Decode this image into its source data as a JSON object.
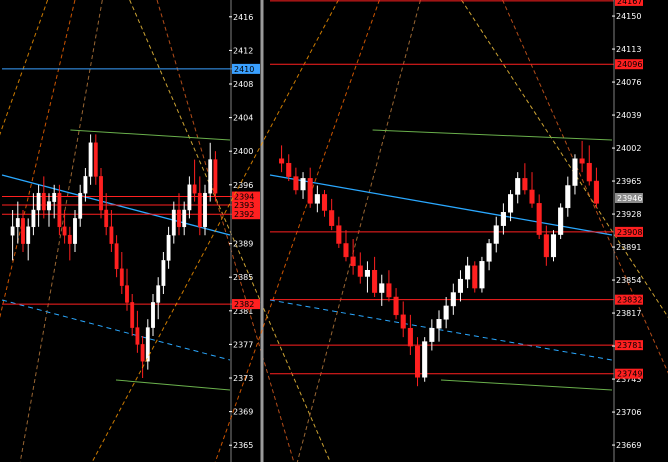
{
  "chart_data": [
    {
      "type": "candlestick",
      "y_ticks": [
        2416,
        2412,
        2408,
        2404,
        2400,
        2396,
        2389,
        2385,
        2381,
        2377,
        2373,
        2369,
        2365
      ],
      "ylim": [
        2363,
        2418
      ],
      "badges": [
        {
          "label": "2410",
          "price": 2409.8,
          "bg": "#3aa0ff",
          "fg": "#000000"
        },
        {
          "label": "2394",
          "price": 2394.6,
          "bg": "#ff2020",
          "fg": "#000000"
        },
        {
          "label": "2393",
          "price": 2393.6,
          "bg": "#ff2020",
          "fg": "#000000"
        },
        {
          "label": "2392",
          "price": 2392.5,
          "bg": "#ff2020",
          "fg": "#000000"
        },
        {
          "label": "2382",
          "price": 2381.8,
          "bg": "#ff2020",
          "fg": "#000000"
        }
      ],
      "candles": [
        [
          2390,
          2393,
          2387,
          2391
        ],
        [
          2391,
          2394,
          2389,
          2392
        ],
        [
          2392,
          2393,
          2388,
          2389
        ],
        [
          2389,
          2392,
          2387,
          2391
        ],
        [
          2391,
          2395,
          2390,
          2393
        ],
        [
          2393,
          2396,
          2391,
          2395
        ],
        [
          2395,
          2397,
          2392,
          2393
        ],
        [
          2393,
          2395,
          2391,
          2394
        ],
        [
          2394,
          2396,
          2392,
          2395
        ],
        [
          2395,
          2396,
          2390,
          2391
        ],
        [
          2391,
          2393,
          2389,
          2390
        ],
        [
          2390,
          2391,
          2387,
          2389
        ],
        [
          2389,
          2393,
          2388,
          2392
        ],
        [
          2392,
          2396,
          2391,
          2395
        ],
        [
          2395,
          2398,
          2394,
          2397
        ],
        [
          2397,
          2402,
          2396,
          2401
        ],
        [
          2401,
          2402,
          2396,
          2397
        ],
        [
          2397,
          2398,
          2392,
          2393
        ],
        [
          2393,
          2395,
          2390,
          2391
        ],
        [
          2391,
          2393,
          2388,
          2389
        ],
        [
          2389,
          2390,
          2385,
          2386
        ],
        [
          2386,
          2388,
          2383,
          2384
        ],
        [
          2384,
          2386,
          2381,
          2382
        ],
        [
          2382,
          2383,
          2378,
          2379
        ],
        [
          2379,
          2381,
          2376,
          2377
        ],
        [
          2377,
          2378,
          2373,
          2375
        ],
        [
          2375,
          2380,
          2374,
          2379
        ],
        [
          2379,
          2383,
          2378,
          2382
        ],
        [
          2382,
          2385,
          2380,
          2384
        ],
        [
          2384,
          2388,
          2383,
          2387
        ],
        [
          2387,
          2391,
          2386,
          2390
        ],
        [
          2390,
          2394,
          2389,
          2393
        ],
        [
          2393,
          2395,
          2390,
          2391
        ],
        [
          2391,
          2394,
          2390,
          2393
        ],
        [
          2393,
          2397,
          2392,
          2396
        ],
        [
          2396,
          2399,
          2394,
          2395
        ],
        [
          2395,
          2397,
          2390,
          2391
        ],
        [
          2391,
          2396,
          2390,
          2395
        ],
        [
          2395,
          2401,
          2394,
          2399
        ],
        [
          2399,
          2400,
          2394,
          2395
        ]
      ]
    },
    {
      "type": "candlestick",
      "y_ticks": [
        24150,
        24113,
        24076,
        24039,
        24002,
        23965,
        23928,
        23891,
        23854,
        23817,
        23780,
        23743,
        23706,
        23669
      ],
      "ylim": [
        23650,
        24168
      ],
      "price_label": {
        "label": "23946",
        "price": 23946,
        "bg": "#8c8c8c",
        "fg": "#ffffff"
      },
      "badges": [
        {
          "label": "24167",
          "price": 24167,
          "bg": "#ff2020",
          "fg": "#000000"
        },
        {
          "label": "24096",
          "price": 24096,
          "bg": "#ff2020",
          "fg": "#000000"
        },
        {
          "label": "23908",
          "price": 23908,
          "bg": "#ff2020",
          "fg": "#000000"
        },
        {
          "label": "23832",
          "price": 23832,
          "bg": "#ff2020",
          "fg": "#000000"
        },
        {
          "label": "23781",
          "price": 23781,
          "bg": "#ff2020",
          "fg": "#000000"
        },
        {
          "label": "23749",
          "price": 23749,
          "bg": "#ff2020",
          "fg": "#000000"
        }
      ],
      "candles": [
        [
          23990,
          24005,
          23975,
          23985
        ],
        [
          23985,
          23995,
          23965,
          23970
        ],
        [
          23970,
          23980,
          23950,
          23955
        ],
        [
          23955,
          23975,
          23945,
          23968
        ],
        [
          23968,
          23980,
          23935,
          23940
        ],
        [
          23940,
          23960,
          23930,
          23950
        ],
        [
          23950,
          23955,
          23925,
          23932
        ],
        [
          23932,
          23945,
          23910,
          23915
        ],
        [
          23915,
          23925,
          23890,
          23895
        ],
        [
          23895,
          23910,
          23875,
          23880
        ],
        [
          23880,
          23900,
          23860,
          23870
        ],
        [
          23870,
          23885,
          23850,
          23858
        ],
        [
          23858,
          23875,
          23840,
          23865
        ],
        [
          23865,
          23880,
          23835,
          23840
        ],
        [
          23840,
          23860,
          23825,
          23850
        ],
        [
          23850,
          23865,
          23830,
          23835
        ],
        [
          23835,
          23845,
          23810,
          23815
        ],
        [
          23815,
          23830,
          23790,
          23800
        ],
        [
          23800,
          23815,
          23770,
          23780
        ],
        [
          23780,
          23790,
          23735,
          23745
        ],
        [
          23745,
          23790,
          23740,
          23785
        ],
        [
          23785,
          23810,
          23775,
          23800
        ],
        [
          23800,
          23820,
          23785,
          23810
        ],
        [
          23810,
          23835,
          23800,
          23825
        ],
        [
          23825,
          23850,
          23815,
          23840
        ],
        [
          23840,
          23865,
          23830,
          23855
        ],
        [
          23855,
          23880,
          23845,
          23870
        ],
        [
          23870,
          23875,
          23840,
          23845
        ],
        [
          23845,
          23880,
          23840,
          23875
        ],
        [
          23875,
          23900,
          23865,
          23895
        ],
        [
          23895,
          23925,
          23885,
          23915
        ],
        [
          23915,
          23940,
          23905,
          23930
        ],
        [
          23930,
          23955,
          23920,
          23950
        ],
        [
          23950,
          23975,
          23940,
          23968
        ],
        [
          23968,
          23985,
          23950,
          23955
        ],
        [
          23955,
          23975,
          23935,
          23940
        ],
        [
          23940,
          23950,
          23900,
          23905
        ],
        [
          23905,
          23915,
          23870,
          23880
        ],
        [
          23880,
          23910,
          23875,
          23905
        ],
        [
          23905,
          23940,
          23900,
          23935
        ],
        [
          23935,
          23970,
          23925,
          23960
        ],
        [
          23960,
          23995,
          23950,
          23990
        ],
        [
          23990,
          24010,
          23975,
          23985
        ],
        [
          23985,
          24005,
          23960,
          23965
        ],
        [
          23965,
          23980,
          23935,
          23940
        ]
      ]
    }
  ]
}
